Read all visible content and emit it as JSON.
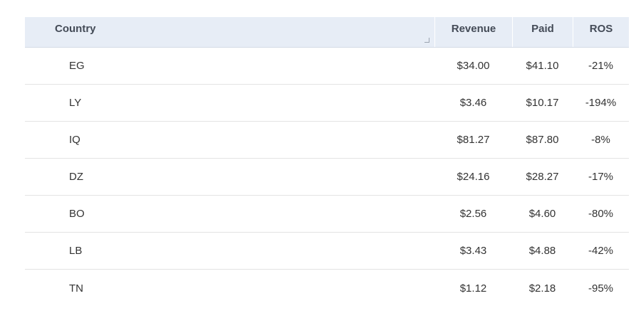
{
  "table": {
    "columns": {
      "country": "Country",
      "revenue": "Revenue",
      "paid": "Paid",
      "ros": "ROS"
    },
    "rows": [
      {
        "country": "EG",
        "revenue": "$34.00",
        "paid": "$41.10",
        "ros": "-21%"
      },
      {
        "country": "LY",
        "revenue": "$3.46",
        "paid": "$10.17",
        "ros": "-194%"
      },
      {
        "country": "IQ",
        "revenue": "$81.27",
        "paid": "$87.80",
        "ros": "-8%"
      },
      {
        "country": "DZ",
        "revenue": "$24.16",
        "paid": "$28.27",
        "ros": "-17%"
      },
      {
        "country": "BO",
        "revenue": "$2.56",
        "paid": "$4.60",
        "ros": "-80%"
      },
      {
        "country": "LB",
        "revenue": "$3.43",
        "paid": "$4.88",
        "ros": "-42%"
      },
      {
        "country": "TN",
        "revenue": "$1.12",
        "paid": "$2.18",
        "ros": "-95%"
      }
    ]
  },
  "icons": {
    "column_resize": "resize-handle-icon"
  }
}
